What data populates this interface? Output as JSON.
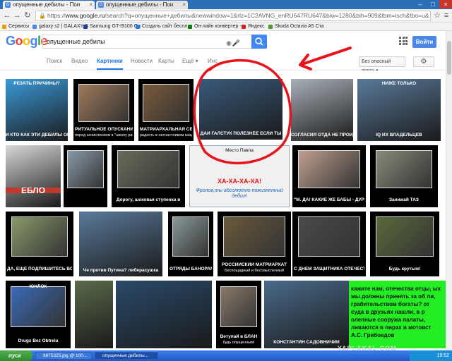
{
  "browser": {
    "tabs": [
      {
        "title": "опущенные дебилы - Пои"
      },
      {
        "title": "опущенные дебилы - Пои"
      }
    ],
    "url_scheme": "https://",
    "url_host": "www.google.ru",
    "url_path": "/search?q=опущенные+дебилы&newwindow=1&rlz=1C2AVNG_enRU647RU647&biw=1280&bih=909&tbm=isch&tbo=u&"
  },
  "bookmarks": [
    {
      "label": "Сервисы",
      "color": "#e8a000"
    },
    {
      "label": "galaxy s2 | GALAXY S",
      "color": "#4a86e8"
    },
    {
      "label": "Samsung GT-I9100 Ga",
      "color": "#1c3f94"
    },
    {
      "label": "Создать сайт беспл",
      "color": "#2b78e4"
    },
    {
      "label": "Он-лайн конвертер -",
      "color": "#0a7d0a"
    },
    {
      "label": "Яндекс",
      "color": "#d81f1f"
    },
    {
      "label": "Skoda Octavia A5 Ста",
      "color": "#4a9a2a"
    }
  ],
  "google": {
    "logo_letters": [
      "G",
      "o",
      "o",
      "g",
      "l",
      "e"
    ],
    "logo_colors": [
      "#4285f4",
      "#ea4335",
      "#fbbc05",
      "#4285f4",
      "#34a853",
      "#ea4335"
    ],
    "query": "опущенные дебилы",
    "signin_label": "Войти"
  },
  "menu": {
    "items": [
      "Поиск",
      "Видео",
      "Картинки",
      "Новости",
      "Карты",
      "Ещё ▾",
      "Инс"
    ],
    "active_index": 2,
    "safesearch_label": "Без опасный поиск ▾"
  },
  "images": [
    {
      "caption_top": "РЕЗАТЬ ПРИЧИНЫ?",
      "caption": "И КТО КАК ЭТИ ДЕБИЛЫ ОПУЩЕННЫЕ ЕЗДЯТ?!",
      "bg": "#3a9ad9"
    },
    {
      "caption": "РИТУАЛЬНОЕ ОПУСКАНИЕ",
      "sub": "перед зачислением в \"школу рабочих\"",
      "bg": "#a07a5a"
    },
    {
      "caption": "МАТРИАРХАЛЬНАЯ СЕМЬЯ -",
      "sub": "радость в несчастливом каждой доме",
      "bg": "#7a5a3a"
    },
    {
      "caption": "ДАЙ ГАЛСТУК ПОЛЕЗНЕЕ ЕСЛИ ТЫ",
      "bg": "#3a5a7a"
    },
    {
      "caption": "СОГЛАСИЯ ОТДА НЕ ПРОЙДЁТСЯ!",
      "bg": "#a8b0b8"
    },
    {
      "caption_top": "НИЖЕ ТОЛЬКО",
      "caption": "IQ ИХ ВЛАДЕЛЬЦЕВ",
      "bg": "#5a7a9a"
    },
    {
      "caption": "ЕБЛО",
      "bg": "#d8d8d8"
    },
    {
      "caption": "",
      "bg": "#8a9aa8"
    },
    {
      "caption": "Дорогу, шоковая ступенка в",
      "bg": "#6a6a5a"
    },
    {
      "caption_top": "Место Павла",
      "caption": "ХА-ХА-ХА-ХА!",
      "sub": "Фролов,ты абсолютно пожизненный дебил!",
      "bg": "#f0f0f0"
    },
    {
      "caption": "\"М. ДА! КАКИЕ ЖЕ БАБЫ - ДУРЫ!\"",
      "bg": "#c0a090"
    },
    {
      "caption": "Занижай ТАЗ",
      "bg": "#8a8a7a"
    },
    {
      "caption": "ДА, ЕЩЁ ПОДПИШИТЕСЬ ВОТ ТУТ:",
      "bg": "#8a9a6a"
    },
    {
      "caption": "Че против Путина? либерасушка",
      "bg": "#5a7a9a"
    },
    {
      "caption": "ОТРЯДЫ БАНОРАМ",
      "bg": "#8a9a9a"
    },
    {
      "caption": "РОССИЙСКИЙ МАТРИАРХАТ",
      "sub": "Беспощадный и бессмысленный",
      "bg": "#6a5a3a"
    },
    {
      "caption": "С ДНЕМ ЗАЩИТНИКА ОТЕЧЕСТВА!",
      "bg": "#4a4a4a"
    },
    {
      "caption": "Будь крутым!",
      "bg": "#5a6a3a"
    },
    {
      "caption_top": "ЮНЛОК",
      "caption": "Drugs Bez Obtrela",
      "bg": "#3a6ab8"
    },
    {
      "caption": "",
      "bg": "#5a6a4a"
    },
    {
      "caption": "",
      "bg": "#2a4a6a"
    },
    {
      "caption": "Ветупай в БЛАН",
      "sub": "будь опущенным!",
      "bg": "#8a7a6a"
    },
    {
      "caption": "КОНСТАНТИН САДОВНИЧИЙ",
      "bg": "#4a6a8a"
    },
    {
      "caption": "кажите нам, отечества отцы, ых мы должны принять за об ли, грабительством богаты? от суда в друзьях нашли, в р олепные сооружа палаты, ливаются в пирах и мотовст А.С. Грибоедов",
      "bg": "#22ee22"
    }
  ],
  "taskbar": {
    "start_label": "пуск",
    "tasks": [
      "6875325.jpg @ 100...",
      "опущенные дебилы..."
    ],
    "clock": "19:52"
  },
  "watermark": "YAPLAKAL.COM",
  "annotation_color": "#e8141c"
}
